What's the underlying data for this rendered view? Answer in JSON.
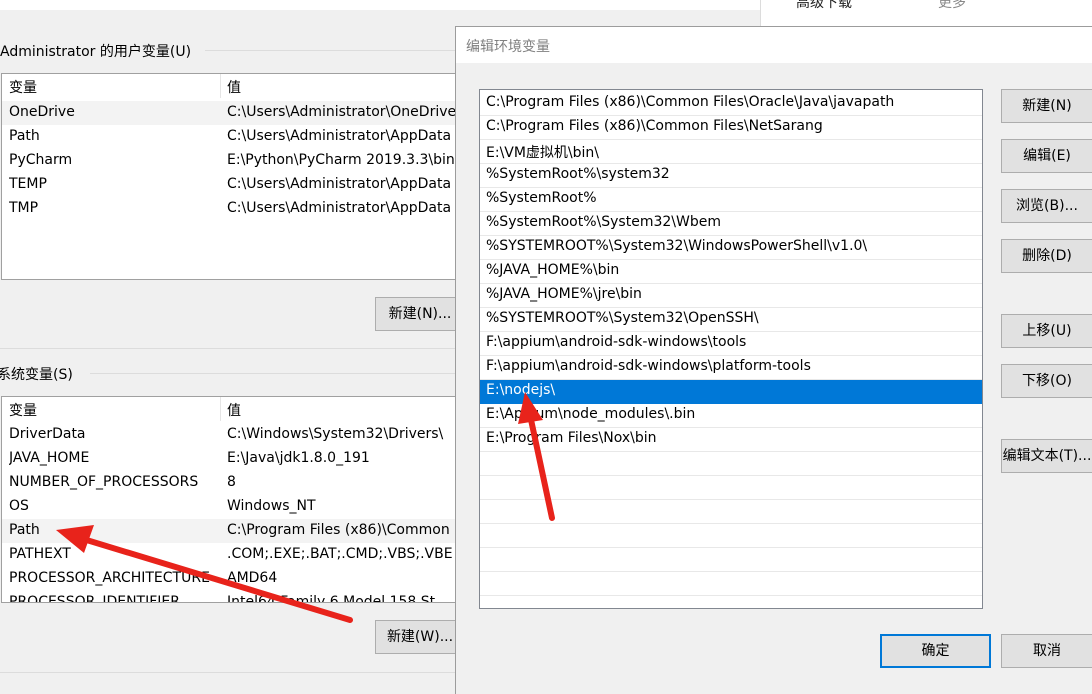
{
  "background_window": {
    "top_right": {
      "item1": "高级下载",
      "item2": "更多"
    },
    "user_vars": {
      "label": "Administrator 的用户变量(U)",
      "columns": [
        "变量",
        "值"
      ],
      "rows": [
        {
          "name": "OneDrive",
          "value": "C:\\Users\\Administrator\\OneDrive"
        },
        {
          "name": "Path",
          "value": "C:\\Users\\Administrator\\AppData"
        },
        {
          "name": "PyCharm",
          "value": "E:\\Python\\PyCharm 2019.3.3\\bin"
        },
        {
          "name": "TEMP",
          "value": "C:\\Users\\Administrator\\AppData"
        },
        {
          "name": "TMP",
          "value": "C:\\Users\\Administrator\\AppData"
        }
      ],
      "new_button": "新建(N)..."
    },
    "system_vars": {
      "label": "系统变量(S)",
      "columns": [
        "变量",
        "值"
      ],
      "rows": [
        {
          "name": "DriverData",
          "value": "C:\\Windows\\System32\\Drivers\\"
        },
        {
          "name": "JAVA_HOME",
          "value": "E:\\Java\\jdk1.8.0_191"
        },
        {
          "name": "NUMBER_OF_PROCESSORS",
          "value": "8"
        },
        {
          "name": "OS",
          "value": "Windows_NT"
        },
        {
          "name": "Path",
          "value": "C:\\Program Files (x86)\\Common"
        },
        {
          "name": "PATHEXT",
          "value": ".COM;.EXE;.BAT;.CMD;.VBS;.VBE"
        },
        {
          "name": "PROCESSOR_ARCHITECTURE",
          "value": "AMD64"
        },
        {
          "name": "PROCESSOR_IDENTIFIER",
          "value": "Intel64 Family 6 Model 158 St"
        }
      ],
      "new_button": "新建(W)..."
    }
  },
  "dialog": {
    "title": "编辑环境变量",
    "paths": [
      "C:\\Program Files (x86)\\Common Files\\Oracle\\Java\\javapath",
      "C:\\Program Files (x86)\\Common Files\\NetSarang",
      "E:\\VM虚拟机\\bin\\",
      "%SystemRoot%\\system32",
      "%SystemRoot%",
      "%SystemRoot%\\System32\\Wbem",
      "%SYSTEMROOT%\\System32\\WindowsPowerShell\\v1.0\\",
      "%JAVA_HOME%\\bin",
      "%JAVA_HOME%\\jre\\bin",
      "%SYSTEMROOT%\\System32\\OpenSSH\\",
      "F:\\appium\\android-sdk-windows\\tools",
      "F:\\appium\\android-sdk-windows\\platform-tools",
      "E:\\nodejs\\",
      "E:\\Appium\\node_modules\\.bin",
      "E:\\Program Files\\Nox\\bin"
    ],
    "selected_index": 12,
    "buttons": {
      "new": "新建(N)",
      "edit": "编辑(E)",
      "browse": "浏览(B)...",
      "delete": "删除(D)",
      "move_up": "上移(U)",
      "move_down": "下移(O)",
      "edit_text": "编辑文本(T)...",
      "ok": "确定",
      "cancel": "取消"
    }
  },
  "colors": {
    "selection": "#0078d7",
    "annotation_arrow": "#e8231b"
  }
}
